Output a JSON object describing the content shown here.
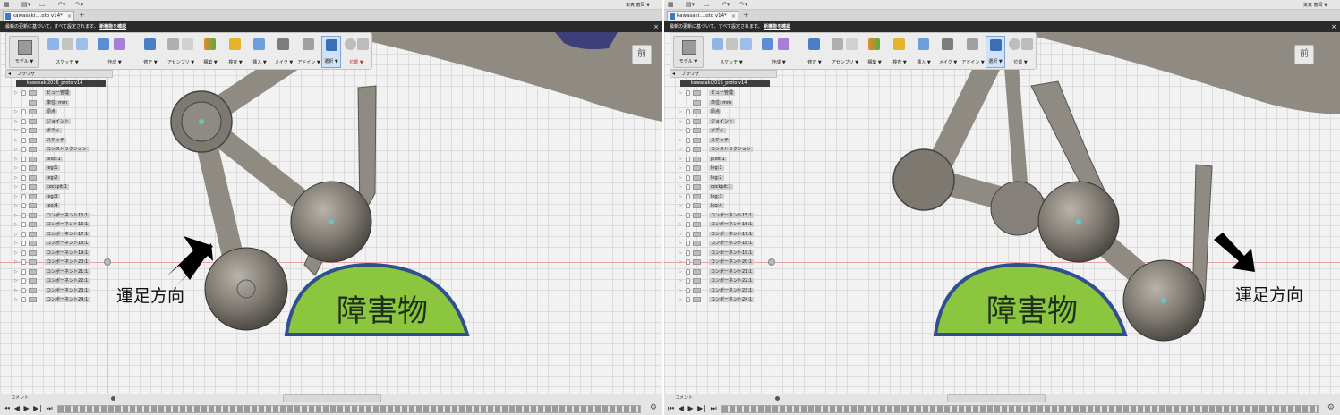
{
  "window": {
    "user_name": "東真 富岡 ▼",
    "tab_title": "kawasaki....oto v14*",
    "new_tab": "+"
  },
  "notice": {
    "message": "最新の更新に基づいて、すべて設定されます。",
    "link": "新機能を確認",
    "close": "×"
  },
  "toolbar": {
    "workspace": "モデル ▼",
    "groups": [
      "スケッチ ▼",
      "作成 ▼",
      "修正 ▼",
      "アセンブリ ▼",
      "構築 ▼",
      "検査 ▼",
      "挿入 ▼",
      "メイク ▼",
      "アドイン ▼",
      "選択 ▼",
      "位置 ▼"
    ],
    "mae_button": "前"
  },
  "browser": {
    "header": "ブラウザ",
    "root": "kawasaki2016_proto v14",
    "items": [
      "ビュー管理",
      "単位: mm",
      "原点",
      "ジョイント",
      "ボディ",
      "スケッチ",
      "コンストラクション",
      "pilot:1",
      "leg:1",
      "leg:2",
      "cockpit:1",
      "leg:3",
      "leg:4",
      "コンポーネント15:1",
      "コンポーネント16:1",
      "コンポーネント17:1",
      "コンポーネント18:1",
      "コンポーネント19:1",
      "コンポーネント20:1",
      "コンポーネント21:1",
      "コンポーネント22:1",
      "コンポーネント23:1",
      "コンポーネント24:1"
    ]
  },
  "bottom": {
    "comment_label": "コメント",
    "playback": "⏮ ◀ ▶ ▶| ⏭"
  },
  "annotations": {
    "obstacle": "障害物",
    "direction": "運足方向"
  },
  "colors": {
    "obstacle_fill": "#8cc63f",
    "obstacle_border": "#2f4f8f",
    "tube": "#8f8a82",
    "joint": "#7d7870",
    "notice_bg": "#2a2a2a"
  }
}
